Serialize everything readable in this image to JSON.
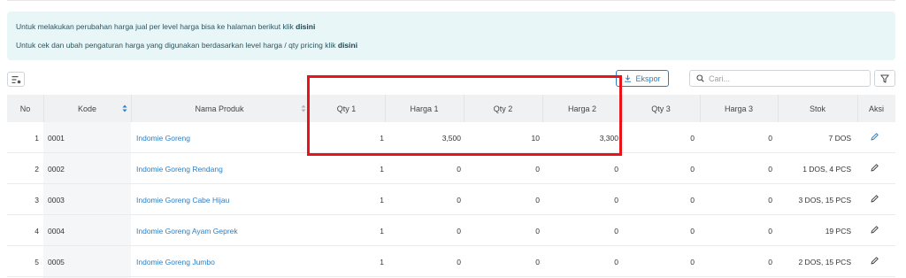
{
  "alert": {
    "line1_text": "Untuk melakukan perubahan harga jual per level harga bisa ke halaman berikut klik",
    "line1_link": "disini",
    "line2_text": "Untuk cek dan ubah pengaturan harga yang digunakan berdasarkan level harga / qty pricing klik",
    "line2_link": "disini"
  },
  "toolbar": {
    "columns_icon": "column-settings-icon",
    "export_label": "Ekspor",
    "export_icon": "download-icon",
    "search_placeholder": "Cari...",
    "filter_icon": "filter-icon"
  },
  "table": {
    "headers": {
      "no": "No",
      "kode": "Kode",
      "nama": "Nama Produk",
      "qty1": "Qty 1",
      "harga1": "Harga 1",
      "qty2": "Qty 2",
      "harga2": "Harga 2",
      "qty3": "Qty 3",
      "harga3": "Harga 3",
      "stok": "Stok",
      "aksi": "Aksi"
    },
    "rows": [
      {
        "no": "1",
        "kode": "0001",
        "nama": "Indomie Goreng",
        "qty1": "1",
        "harga1": "3,500",
        "qty2": "10",
        "harga2": "3,300",
        "qty3": "0",
        "harga3": "0",
        "stok": "7 DOS"
      },
      {
        "no": "2",
        "kode": "0002",
        "nama": "Indomie Goreng Rendang",
        "qty1": "1",
        "harga1": "0",
        "qty2": "0",
        "harga2": "0",
        "qty3": "0",
        "harga3": "0",
        "stok": "1 DOS, 4 PCS"
      },
      {
        "no": "3",
        "kode": "0003",
        "nama": "Indomie Goreng Cabe Hijau",
        "qty1": "1",
        "harga1": "0",
        "qty2": "0",
        "harga2": "0",
        "qty3": "0",
        "harga3": "0",
        "stok": "3 DOS, 15 PCS"
      },
      {
        "no": "4",
        "kode": "0004",
        "nama": "Indomie Goreng Ayam Geprek",
        "qty1": "1",
        "harga1": "0",
        "qty2": "0",
        "harga2": "0",
        "qty3": "0",
        "harga3": "0",
        "stok": "19 PCS"
      },
      {
        "no": "5",
        "kode": "0005",
        "nama": "Indomie Goreng Jumbo",
        "qty1": "1",
        "harga1": "0",
        "qty2": "0",
        "harga2": "0",
        "qty3": "0",
        "harga3": "0",
        "stok": "2 DOS, 15 PCS"
      }
    ]
  },
  "colors": {
    "accent": "#2a7fc9",
    "alert_bg": "#e8f6f8",
    "header_bg": "#f0f1f3",
    "highlight_box": "#e8141a"
  }
}
